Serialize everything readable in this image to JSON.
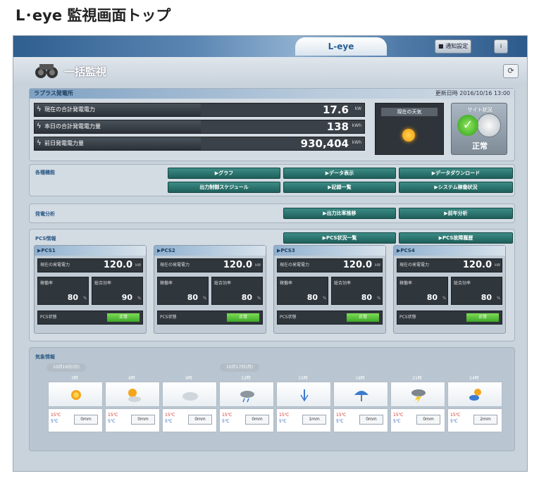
{
  "page_title": "L･eye 監視画面トップ",
  "app": {
    "logo": "L-eye",
    "notice_btn": "通知設定",
    "info_btn": "i"
  },
  "header": {
    "title": "一括監視"
  },
  "plant": {
    "name": "ラプラス発電所",
    "updated": "更新日時 2016/10/16 13:00",
    "kpis": [
      {
        "label": "現在の合計発電電力",
        "value": "17.6",
        "unit": "kW"
      },
      {
        "label": "本日の合計発電電力量",
        "value": "138",
        "unit": "kWh"
      },
      {
        "label": "前日発電電力量",
        "value": "930,404",
        "unit": "kWh"
      }
    ],
    "weather_label": "現在の天気",
    "site_status_label": "サイト状況",
    "site_status": "正常"
  },
  "buttons": {
    "section_label": "各種機能",
    "graph": "▶グラフ",
    "data_display": "▶データ表示",
    "data_download": "▶データダウンロード",
    "output_schedule": "出力制御スケジュール",
    "log_list": "▶記録一覧",
    "system_info": "▶システム稼働状況"
  },
  "analysis": {
    "section_label": "発電分析",
    "output_ratio": "▶出力比率推移",
    "yearly": "▶前年分析"
  },
  "pcs_section": {
    "label": "PCS情報",
    "list_btn": "▶PCS状況一覧",
    "history_btn": "▶PCS故障履歴",
    "cards": [
      {
        "name": "▶PCS1",
        "power_label": "現在の発電電力",
        "power": "120.0",
        "unit": "kW",
        "sub1_label": "稼働率",
        "sub1": "80",
        "sub2_label": "総合効率",
        "sub2": "90",
        "status_label": "PCS状態",
        "status": "正常"
      },
      {
        "name": "▶PCS2",
        "power_label": "現在の発電電力",
        "power": "120.0",
        "unit": "kW",
        "sub1_label": "稼働率",
        "sub1": "80",
        "sub2_label": "総合効率",
        "sub2": "80",
        "status_label": "PCS状態",
        "status": "正常"
      },
      {
        "name": "▶PCS3",
        "power_label": "現在の発電電力",
        "power": "120.0",
        "unit": "kW",
        "sub1_label": "稼働率",
        "sub1": "80",
        "sub2_label": "総合効率",
        "sub2": "80",
        "status_label": "PCS状態",
        "status": "正常"
      },
      {
        "name": "▶PCS4",
        "power_label": "現在の発電電力",
        "power": "120.0",
        "unit": "kW",
        "sub1_label": "稼働率",
        "sub1": "80",
        "sub2_label": "総合効率",
        "sub2": "80",
        "status_label": "PCS状態",
        "status": "正常"
      }
    ]
  },
  "forecast": {
    "label": "気象情報",
    "date_pill_1": "10月16日(日)",
    "date_pill_2": "10月17日(月)",
    "days": [
      {
        "time": "3時",
        "icon": "sun-icon",
        "hi": "15℃",
        "lo": "5℃",
        "rain": "0mm"
      },
      {
        "time": "6時",
        "icon": "sun-cloud-icon",
        "hi": "15℃",
        "lo": "5℃",
        "rain": "0mm"
      },
      {
        "time": "9時",
        "icon": "cloud-icon",
        "hi": "15℃",
        "lo": "5℃",
        "rain": "0mm"
      },
      {
        "time": "12時",
        "icon": "cloud-rain-icon",
        "hi": "15℃",
        "lo": "5℃",
        "rain": "0mm"
      },
      {
        "time": "15時",
        "icon": "rain-icon",
        "hi": "15℃",
        "lo": "5℃",
        "rain": "1mm"
      },
      {
        "time": "18時",
        "icon": "umbrella-icon",
        "hi": "15℃",
        "lo": "5℃",
        "rain": "0mm"
      },
      {
        "time": "21時",
        "icon": "thunder-icon",
        "hi": "15℃",
        "lo": "5℃",
        "rain": "0mm"
      },
      {
        "time": "24時",
        "icon": "snow-icon",
        "hi": "15℃",
        "lo": "5℃",
        "rain": "2mm"
      }
    ]
  },
  "colors": {
    "accent_green": "#1f5f5a",
    "ok_green": "#3ea82a",
    "header_blue": "#2f5f8f"
  }
}
